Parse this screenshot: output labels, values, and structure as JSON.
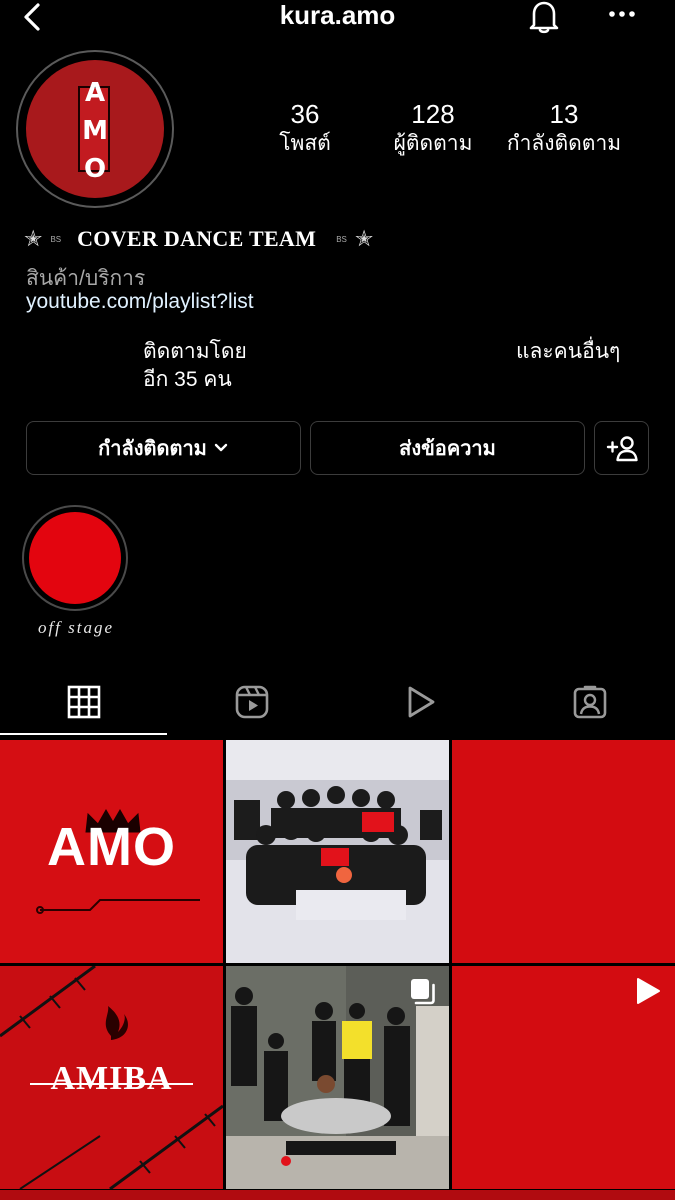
{
  "header": {
    "username": "kura.amo",
    "back_icon": "chevron-left-icon",
    "bell_icon": "bell-icon",
    "more_icon": "more-horizontal-icon"
  },
  "avatar": {
    "letters": "A\nM\nO",
    "color": "#a8191c"
  },
  "stats": [
    {
      "value": "36",
      "label": "โพสต์"
    },
    {
      "value": "128",
      "label": "ผู้ติดตาม"
    },
    {
      "value": "13",
      "label": "กำลังติดตาม"
    }
  ],
  "bio": {
    "name": "COVER DANCE TEAM",
    "tag_left": "BS",
    "tag_right": "BS",
    "category": "สินค้า/บริการ",
    "website": "youtube.com/playlist?list",
    "followed_by_line1": "ติดตามโดย",
    "followed_by_line2": "อีก 35 คน",
    "and_others": "และคนอื่นๆ"
  },
  "buttons": {
    "following": "กำลังติดตาม",
    "message": "ส่งข้อความ",
    "add_user_icon": "add-user-icon"
  },
  "highlights": [
    {
      "label": "off stage",
      "color": "#e3050f"
    }
  ],
  "tabs": [
    {
      "icon": "grid-icon",
      "active": true
    },
    {
      "icon": "reels-icon",
      "active": false
    },
    {
      "icon": "play-icon",
      "active": false
    },
    {
      "icon": "tagged-icon",
      "active": false
    }
  ],
  "grid": {
    "tile1_text": "AMO",
    "tile4_text": "AMIBA",
    "accent": "#d50e13"
  }
}
